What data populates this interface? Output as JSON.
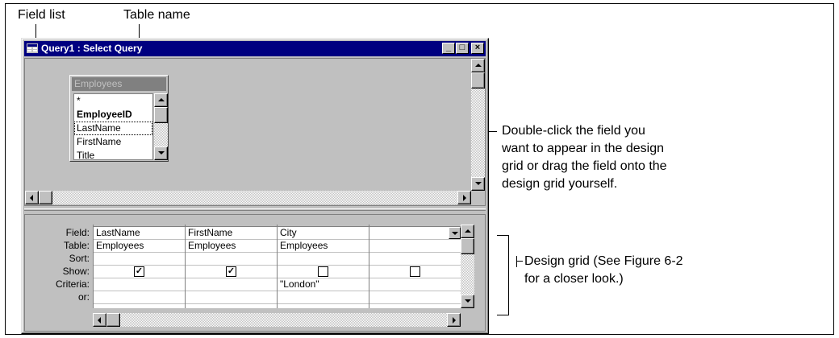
{
  "callouts": {
    "field_list": "Field list",
    "table_name": "Table name",
    "double_click_lines": [
      "Double-click the field you",
      "want to appear in the design",
      "grid or drag the field onto the",
      "design grid yourself."
    ],
    "design_grid_lines": [
      "Design grid (See Figure 6-2",
      "for a closer look.)"
    ]
  },
  "window": {
    "title": "Query1 : Select Query",
    "minimize_glyph": "_",
    "maximize_glyph": "□",
    "close_glyph": "×"
  },
  "field_list": {
    "table": "Employees",
    "items": [
      "*",
      "EmployeeID",
      "LastName",
      "FirstName",
      "Title"
    ]
  },
  "grid": {
    "row_labels": [
      "Field:",
      "Table:",
      "Sort:",
      "Show:",
      "Criteria:",
      "or:"
    ],
    "columns": [
      {
        "field": "LastName",
        "table": "Employees",
        "sort": "",
        "show": true,
        "criteria": "",
        "or": ""
      },
      {
        "field": "FirstName",
        "table": "Employees",
        "sort": "",
        "show": true,
        "criteria": "",
        "or": ""
      },
      {
        "field": "City",
        "table": "Employees",
        "sort": "",
        "show": false,
        "criteria": "\"London\"",
        "or": ""
      },
      {
        "field": "",
        "table": "",
        "sort": "",
        "show": false,
        "criteria": "",
        "or": ""
      }
    ],
    "checked_glyph": "✓"
  }
}
